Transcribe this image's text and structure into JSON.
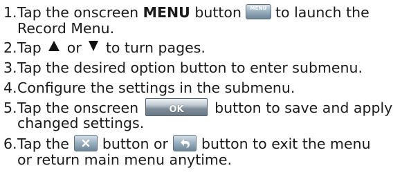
{
  "steps": [
    {
      "num": "1.",
      "pre": "Tap the onscreen",
      "bold": "MENU",
      "mid": "button",
      "icon_label": "MENU",
      "post_line1": "to launch the",
      "line2": "Record Menu."
    },
    {
      "num": "2.",
      "pre": "Tap",
      "mid": "or",
      "post": "to turn pages."
    },
    {
      "num": "3.",
      "text": "Tap the desired option button to enter submenu."
    },
    {
      "num": "4.",
      "text": "Configure the settings in the submenu."
    },
    {
      "num": "5.",
      "pre": "Tap the onscreen",
      "icon_label": "OK",
      "post_line1": "button to save and apply",
      "line2": "changed settings."
    },
    {
      "num": "6.",
      "pre": "Tap the",
      "mid": "button or",
      "post_line1": "button to exit the menu",
      "line2": "or return main menu anytime."
    }
  ],
  "icons": {
    "menu": "menu-button-icon",
    "up": "up-triangle-icon",
    "down": "down-triangle-icon",
    "ok": "ok-button-icon",
    "close": "close-x-icon",
    "back": "back-arrow-icon"
  }
}
